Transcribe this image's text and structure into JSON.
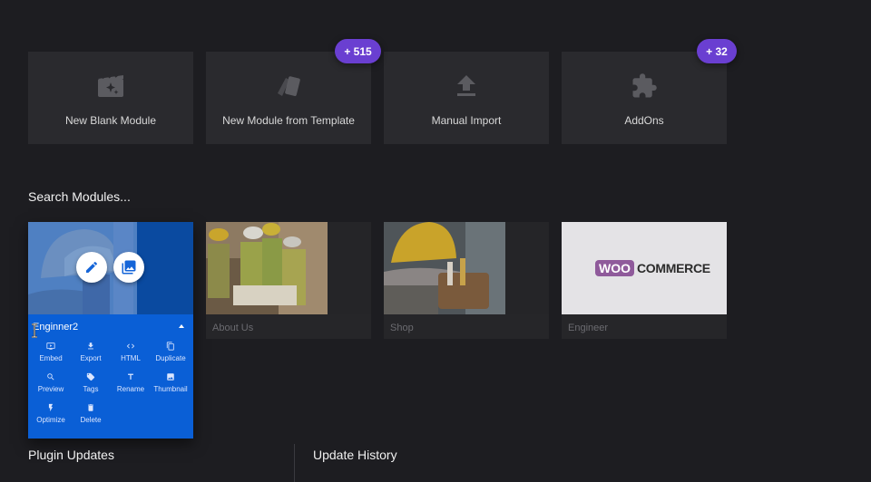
{
  "tiles": [
    {
      "label": "New Blank Module",
      "icon": "clapperboard-sparkle-icon"
    },
    {
      "label": "New Module from Template",
      "icon": "template-cards-icon"
    },
    {
      "label": "Manual Import",
      "icon": "upload-icon"
    },
    {
      "label": "AddOns",
      "icon": "puzzle-icon"
    }
  ],
  "badges": {
    "templates": "+ 515",
    "addons": "+ 32"
  },
  "search": {
    "title": "Search Modules..."
  },
  "modules": [
    {
      "name": "Enginner2",
      "active": true
    },
    {
      "name": "About Us"
    },
    {
      "name": "Shop"
    },
    {
      "name": "Engineer"
    }
  ],
  "woocommerce": {
    "woo": "WOO",
    "commerce": "COMMERCE"
  },
  "actions": [
    {
      "label": "Embed",
      "icon": "embed-icon"
    },
    {
      "label": "Export",
      "icon": "download-icon"
    },
    {
      "label": "HTML",
      "icon": "code-icon"
    },
    {
      "label": "Duplicate",
      "icon": "duplicate-icon"
    },
    {
      "label": "Preview",
      "icon": "search-icon"
    },
    {
      "label": "Tags",
      "icon": "tag-icon"
    },
    {
      "label": "Rename",
      "icon": "text-icon"
    },
    {
      "label": "Thumbnail",
      "icon": "image-icon"
    },
    {
      "label": "Optimize",
      "icon": "bolt-icon"
    },
    {
      "label": "Delete",
      "icon": "trash-icon"
    }
  ],
  "footer": {
    "plugin_updates": "Plugin Updates",
    "update_history": "Update History"
  },
  "colors": {
    "background": "#1d1d21",
    "tile": "#2a2a2e",
    "accent": "#6a3fd1",
    "active_blue": "#0a5fd6"
  }
}
